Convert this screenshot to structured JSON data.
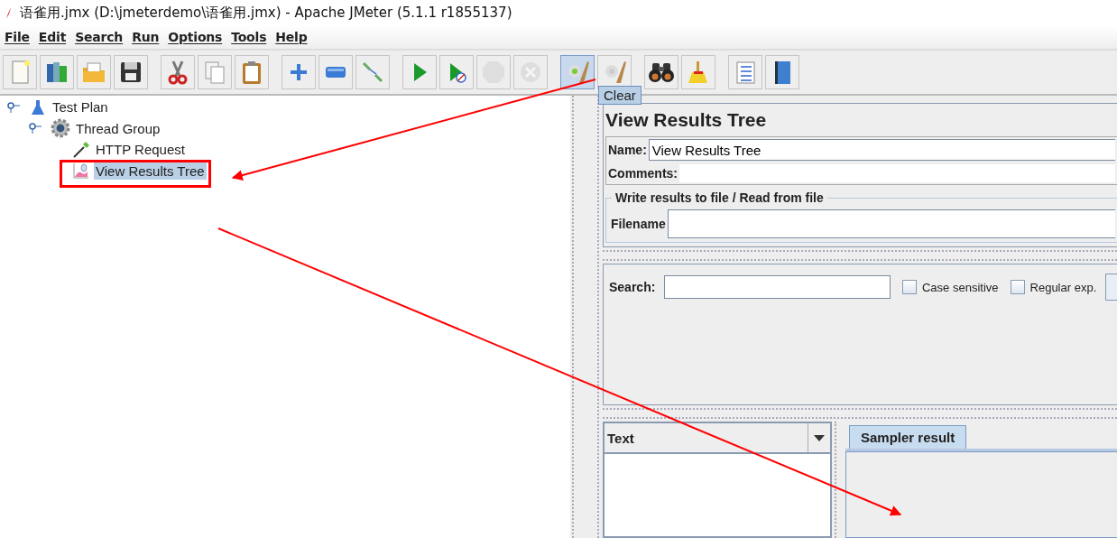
{
  "window": {
    "title": "语雀用.jmx (D:\\jmeterdemo\\语雀用.jmx) - Apache JMeter (5.1.1 r1855137)"
  },
  "menu": [
    {
      "label": "File"
    },
    {
      "label": "Edit"
    },
    {
      "label": "Search"
    },
    {
      "label": "Run"
    },
    {
      "label": "Options"
    },
    {
      "label": "Tools"
    },
    {
      "label": "Help"
    }
  ],
  "toolbar": [
    {
      "disabled": false
    },
    {
      "disabled": false
    },
    {
      "disabled": false
    },
    {
      "disabled": false
    },
    {
      "disabled": false
    },
    {
      "disabled": false
    },
    {
      "disabled": false
    },
    {
      "disabled": false
    },
    {
      "disabled": false
    },
    {
      "disabled": false
    },
    {
      "disabled": false
    },
    {
      "disabled": false
    },
    {
      "disabled": true
    },
    {
      "disabled": true
    },
    {
      "disabled": false,
      "pressed": true
    },
    {
      "disabled": false,
      "pressed": false
    },
    {
      "disabled": false
    },
    {
      "disabled": false
    },
    {
      "disabled": false
    },
    {
      "disabled": false
    }
  ],
  "tooltip": "Clear",
  "tree": [
    {
      "label": "Test Plan",
      "kind": "plan",
      "selected": false,
      "children": [
        {
          "label": "Thread Group",
          "kind": "threads",
          "selected": false,
          "children": [
            {
              "label": "HTTP Request",
              "kind": "sampler",
              "selected": false
            },
            {
              "label": "View Results Tree",
              "kind": "listener",
              "selected": true
            }
          ]
        }
      ]
    }
  ],
  "panel": {
    "title": "View Results Tree",
    "name_label": "Name:",
    "name_value": "View Results Tree",
    "comments_label": "Comments:",
    "file_group": "Write results to file / Read from file",
    "filename_label": "Filename",
    "search_label": "Search:",
    "options": [
      {
        "label": "Case sensitive",
        "checked": false
      },
      {
        "label": "Regular exp.",
        "checked": false
      }
    ],
    "renderer": "Text",
    "tabs": [
      {
        "label": "Sampler result",
        "selected": true
      }
    ]
  }
}
